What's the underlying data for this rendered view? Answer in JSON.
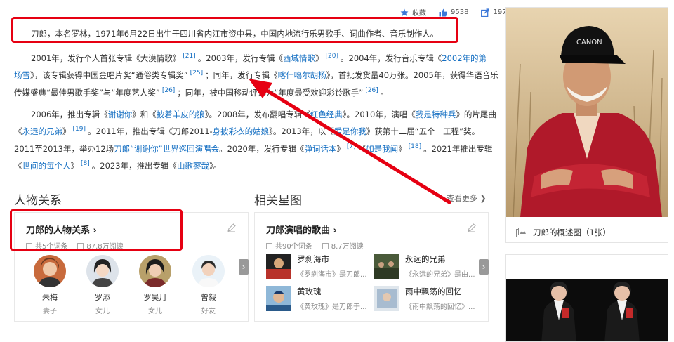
{
  "toolbar": {
    "favorite_label": "收藏",
    "like_count": "9538",
    "share_count": "197"
  },
  "paragraphs": {
    "intro": "刀郎，本名罗林，1971年6月22日出生于四川省内江市资中县，中国内地流行乐男歌手、词曲作者、音乐制作人。",
    "p2": [
      {
        "t": "2001年，发行个人首张专辑《大漠情歌》"
      },
      {
        "sup": "[21]"
      },
      {
        "t": "。2003年，发行专辑《"
      },
      {
        "link": "西域情歌"
      },
      {
        "t": "》"
      },
      {
        "sup": "[20]"
      },
      {
        "t": "。2004年，发行音乐专辑《"
      },
      {
        "link": "2002年的第一场雪"
      },
      {
        "t": "》，该专辑获得中国金唱片奖“通俗类专辑奖”"
      },
      {
        "sup": "[25]"
      },
      {
        "t": "；同年，发行专辑《"
      },
      {
        "link": "喀什噶尔胡杨"
      },
      {
        "t": "》，首批发货量40万张。2005年，获得华语音乐传媒盛典“最佳男歌手奖”与“年度艺人奖”"
      },
      {
        "sup": "[26]"
      },
      {
        "t": "；同年，被中国移动评选为“年度最受欢迎彩铃歌手”"
      },
      {
        "sup": "[26]"
      },
      {
        "t": "。"
      }
    ],
    "p3": [
      {
        "t": "2006年，推出专辑《"
      },
      {
        "link": "谢谢你"
      },
      {
        "t": "》和《"
      },
      {
        "link": "披着羊皮的狼"
      },
      {
        "t": "》。2008年，发布翻唱专辑《"
      },
      {
        "link": "红色经典"
      },
      {
        "t": "》。2010年，演唱《"
      },
      {
        "link": "我是特种兵"
      },
      {
        "t": "》的片尾曲《"
      },
      {
        "link": "永远的兄弟"
      },
      {
        "t": "》"
      },
      {
        "sup": "[19]"
      },
      {
        "t": "。2011年，推出专辑《刀郎2011-"
      },
      {
        "link": "身披彩衣的姑娘"
      },
      {
        "t": "》。2013年，以《"
      },
      {
        "link": "爱是你我"
      },
      {
        "t": "》获第十二届“五个一工程”奖。2011至2013年，举办12场"
      },
      {
        "link": "刀郎“谢谢你”世界巡回演唱会"
      },
      {
        "t": "。2020年，发行专辑《"
      },
      {
        "link": "弹词话本"
      },
      {
        "t": "》"
      },
      {
        "sup": "[7]"
      },
      {
        "t": "《"
      },
      {
        "link": "如是我闻"
      },
      {
        "t": "》"
      },
      {
        "sup": "[18]"
      },
      {
        "t": "。2021年推出专辑《"
      },
      {
        "link": "世间的每个人"
      },
      {
        "t": "》"
      },
      {
        "sup": "[8]"
      },
      {
        "t": "。2023年，推出专辑《"
      },
      {
        "link": "山歌寥哉"
      },
      {
        "t": "》。"
      }
    ]
  },
  "relations": {
    "section_title": "人物关系",
    "card_title": "刀郎的人物关系",
    "entries": "共5个词条",
    "reads": "87.8万阅读",
    "people": [
      {
        "name": "朱梅",
        "role": "妻子"
      },
      {
        "name": "罗添",
        "role": "女儿"
      },
      {
        "name": "罗昊月",
        "role": "女儿"
      },
      {
        "name": "曾毅",
        "role": "好友"
      }
    ]
  },
  "related": {
    "section_title": "相关星图",
    "see_more": "查看更多",
    "card_title": "刀郎演唱的歌曲",
    "entries": "共90个词条",
    "reads": "8.7万阅读",
    "songs": [
      {
        "title": "罗刹海市",
        "desc": "《罗刹海市》是刀郎..."
      },
      {
        "title": "永远的兄弟",
        "desc": "《永远的兄弟》是由..."
      },
      {
        "title": "黄玫瑰",
        "desc": "《黄玫瑰》是刀郎于..."
      },
      {
        "title": "雨中飘荡的回忆",
        "desc": "《雨中飘荡的回忆》..."
      }
    ]
  },
  "photo": {
    "caption": "刀郎的概述图（1张）",
    "cap_text": "CANON"
  },
  "colors": {
    "link": "#136ec2",
    "annotation_red": "#e60012"
  }
}
